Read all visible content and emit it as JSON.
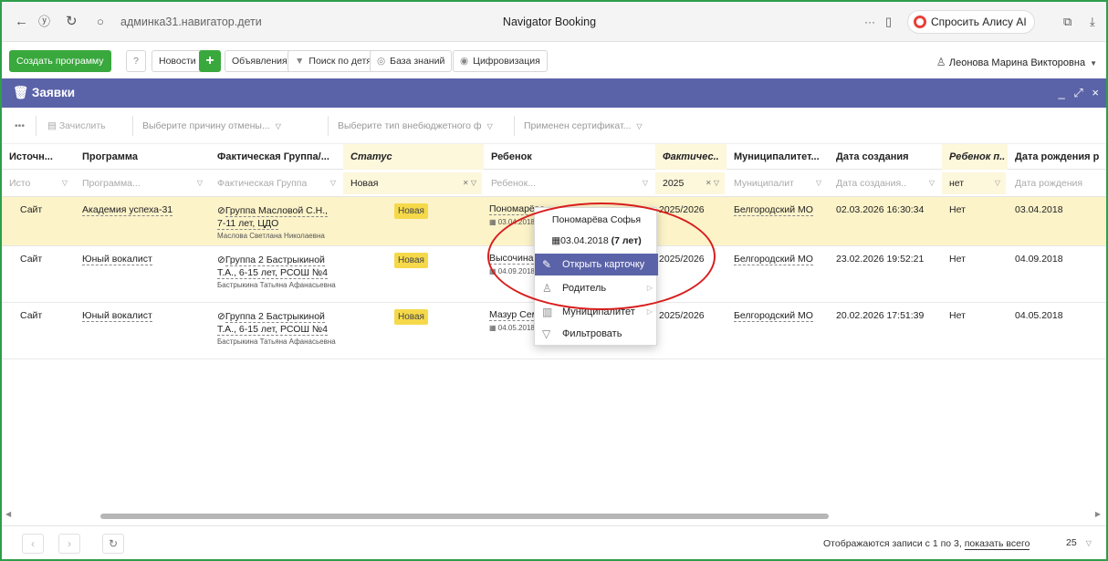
{
  "browser": {
    "url": "админка31.навигатор.дети",
    "title": "Navigator Booking",
    "alice_label": "Спросить Алису AI",
    "icons": [
      "back-icon",
      "yandex-icon",
      "reload-icon",
      "shield-icon",
      "more-icon",
      "bookmark-icon",
      "alice-icon",
      "share-icon",
      "download-icon"
    ]
  },
  "toolbar": {
    "create_label": "Создать программу",
    "news_label": "Новости",
    "ads_label": "Объявления",
    "search_children_label": "Поиск по детям",
    "knowledge_label": "База знаний",
    "digital_label": "Цифровизация",
    "user_name": "Леонова Марина Викторовна"
  },
  "panel": {
    "title": "Заявки"
  },
  "filters": {
    "enroll_label": "Зачислить",
    "reason_placeholder": "Выберите причину отмены...",
    "type_placeholder": "Выберите тип внебюджетного ф",
    "certificate_placeholder": "Применен сертификат..."
  },
  "columns": [
    "Источн...",
    "Программа",
    "Фактическая Группа/...",
    "Статус",
    "Ребенок",
    "Фактичес..",
    "Муниципалитет...",
    "Дата создания",
    "Ребенок п..",
    "Дата рождения р"
  ],
  "column_filters": {
    "source": "Исто",
    "program": "Программа...",
    "group": "Фактическая Группа",
    "status": "Новая",
    "child": "Ребенок...",
    "year": "2025",
    "municipality": "Муниципалит",
    "created": "Дата создания..",
    "child_flag": "нет",
    "birth": "Дата рождения"
  },
  "rows": [
    {
      "source": "Сайт",
      "program": "Академия успеха-31",
      "group": "Группа Масловой С.Н., 7-11 лет, ЦДО",
      "teacher": "Маслова Светлана Николаевна",
      "status": "Новая",
      "child": "Пономарёва Софья",
      "child_date": "03.04.2018",
      "year": "2025/2026",
      "municipality": "Белгородский МО",
      "created": "02.03.2026 16:30:34",
      "flag": "Нет",
      "birth": "03.04.2018"
    },
    {
      "source": "Сайт",
      "program": "Юный вокалист",
      "group": "Группа 2 Бастрыкиной Т.А., 6-15 лет, РСОШ №4",
      "teacher": "Бастрыкина Татьяна Афанасьевна",
      "status": "Новая",
      "child": "Высочина",
      "child_date": "04.09.2018",
      "year": "2025/2026",
      "municipality": "Белгородский МО",
      "created": "23.02.2026 19:52:21",
      "flag": "Нет",
      "birth": "04.09.2018"
    },
    {
      "source": "Сайт",
      "program": "Юный вокалист",
      "group": "Группа 2 Бастрыкиной Т.А., 6-15 лет, РСОШ №4",
      "teacher": "Бастрыкина Татьяна Афанасьевна",
      "status": "Новая",
      "child": "Мазур Сем",
      "child_date": "04.05.2018",
      "year": "2025/2026",
      "municipality": "Белгородский МО",
      "created": "20.02.2026 17:51:39",
      "flag": "Нет",
      "birth": "04.05.2018"
    }
  ],
  "context_menu": {
    "name": "Пономарёва Софья",
    "birth_date": "03.04.2018",
    "age": "(7 лет)",
    "open_card": "Открыть карточку",
    "parent": "Родитель",
    "municipality": "Муниципалитет",
    "filter": "Фильтровать"
  },
  "footer": {
    "records_text": "Отображаются записи с 1 по 3,",
    "show_all": "показать всего",
    "page_size": "25"
  },
  "colors": {
    "accent": "#5b63a8",
    "green": "#39a83d",
    "badge": "#f5d94a",
    "selected_row": "#fcf3c9",
    "highlight": "#d81e1e"
  }
}
